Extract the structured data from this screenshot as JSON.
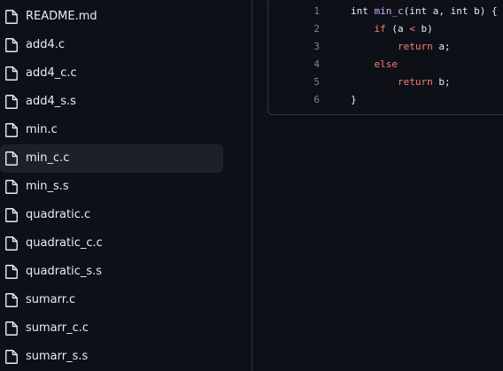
{
  "sidebar": {
    "files": [
      {
        "name": "README.md",
        "icon": "file-icon"
      },
      {
        "name": "add4.c",
        "icon": "file-icon"
      },
      {
        "name": "add4_c.c",
        "icon": "file-icon"
      },
      {
        "name": "add4_s.s",
        "icon": "file-icon"
      },
      {
        "name": "min.c",
        "icon": "file-icon"
      },
      {
        "name": "min_c.c",
        "icon": "file-icon",
        "selected": true
      },
      {
        "name": "min_s.s",
        "icon": "file-icon"
      },
      {
        "name": "quadratic.c",
        "icon": "file-icon"
      },
      {
        "name": "quadratic_c.c",
        "icon": "file-icon"
      },
      {
        "name": "quadratic_s.s",
        "icon": "file-icon"
      },
      {
        "name": "sumarr.c",
        "icon": "file-icon"
      },
      {
        "name": "sumarr_c.c",
        "icon": "file-icon"
      },
      {
        "name": "sumarr_s.s",
        "icon": "file-icon"
      }
    ]
  },
  "code": {
    "lines": [
      {
        "num": "1",
        "tokens": [
          [
            "int ",
            ""
          ],
          [
            "min_c",
            "fn"
          ],
          [
            "(int a, int b) {",
            ""
          ]
        ]
      },
      {
        "num": "2",
        "tokens": [
          [
            "    ",
            ""
          ],
          [
            "if",
            "kw"
          ],
          [
            " (a ",
            ""
          ],
          [
            "<",
            "kw"
          ],
          [
            " b)",
            ""
          ]
        ]
      },
      {
        "num": "3",
        "tokens": [
          [
            "        ",
            ""
          ],
          [
            "return",
            "kw"
          ],
          [
            " a;",
            ""
          ]
        ]
      },
      {
        "num": "4",
        "tokens": [
          [
            "    ",
            ""
          ],
          [
            "else",
            "kw"
          ]
        ]
      },
      {
        "num": "5",
        "tokens": [
          [
            "        ",
            ""
          ],
          [
            "return",
            "kw"
          ],
          [
            " b;",
            ""
          ]
        ]
      },
      {
        "num": "6",
        "tokens": [
          [
            "}",
            ""
          ]
        ]
      }
    ]
  },
  "colors": {
    "background": "#0d1117",
    "selected_row": "#1c2128",
    "border": "#30363d",
    "text": "#e6edf3",
    "line_number": "#7d8590",
    "keyword": "#ff7b72",
    "function": "#d2a8ff"
  }
}
